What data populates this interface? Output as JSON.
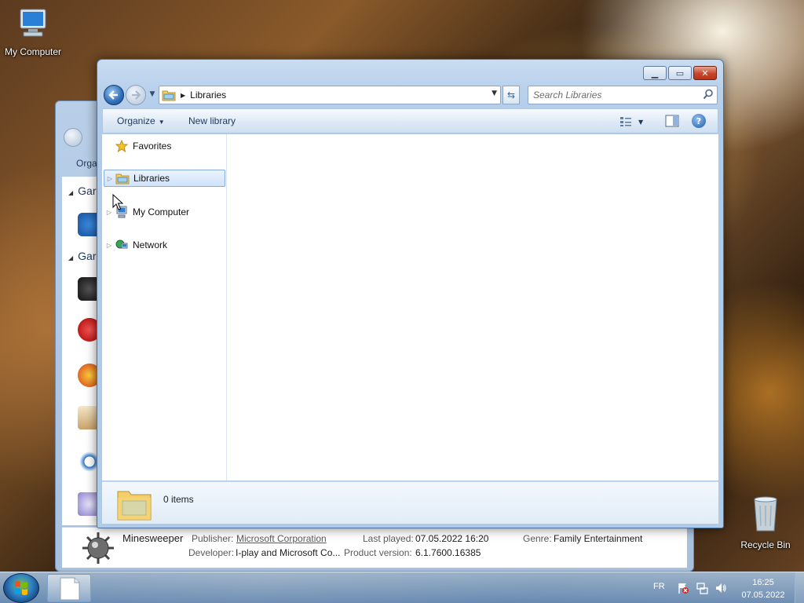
{
  "desktop": {
    "icons": [
      {
        "label": "My Computer",
        "icon": "computer-icon"
      },
      {
        "label": "Recycle Bin",
        "icon": "recycle-bin-icon"
      }
    ]
  },
  "background_window": {
    "toolbar_partial": "Orga",
    "group1": "Gar",
    "group2": "Gar",
    "details": {
      "name": "Minesweeper",
      "publisher_label": "Publisher:",
      "publisher_value": "Microsoft Corporation",
      "developer_label": "Developer:",
      "developer_value": "I-play and Microsoft Co...",
      "last_played_label": "Last played:",
      "last_played_value": "07.05.2022 16:20",
      "product_version_label": "Product version:",
      "product_version_value": "6.1.7600.16385",
      "genre_label": "Genre:",
      "genre_value": "Family Entertainment"
    }
  },
  "explorer": {
    "address": {
      "crumbs": [
        "Libraries"
      ]
    },
    "search": {
      "placeholder": "Search Libraries"
    },
    "toolbar": {
      "organize_label": "Organize",
      "new_library_label": "New library"
    },
    "nav_tree": [
      {
        "label": "Favorites",
        "icon": "star-icon",
        "expandable": false,
        "selected": false
      },
      {
        "label": "Libraries",
        "icon": "libraries-folder-icon",
        "expandable": true,
        "selected": true
      },
      {
        "label": "My Computer",
        "icon": "computer-icon",
        "expandable": true,
        "selected": false
      },
      {
        "label": "Network",
        "icon": "network-icon",
        "expandable": true,
        "selected": false
      }
    ],
    "status": {
      "items_count": "0 items"
    }
  },
  "taskbar": {
    "language": "FR",
    "time": "16:25",
    "date": "07.05.2022"
  },
  "colors": {
    "accent": "#2f6eb6",
    "selection": "#cfe3fb",
    "close_button": "#c7462a"
  }
}
